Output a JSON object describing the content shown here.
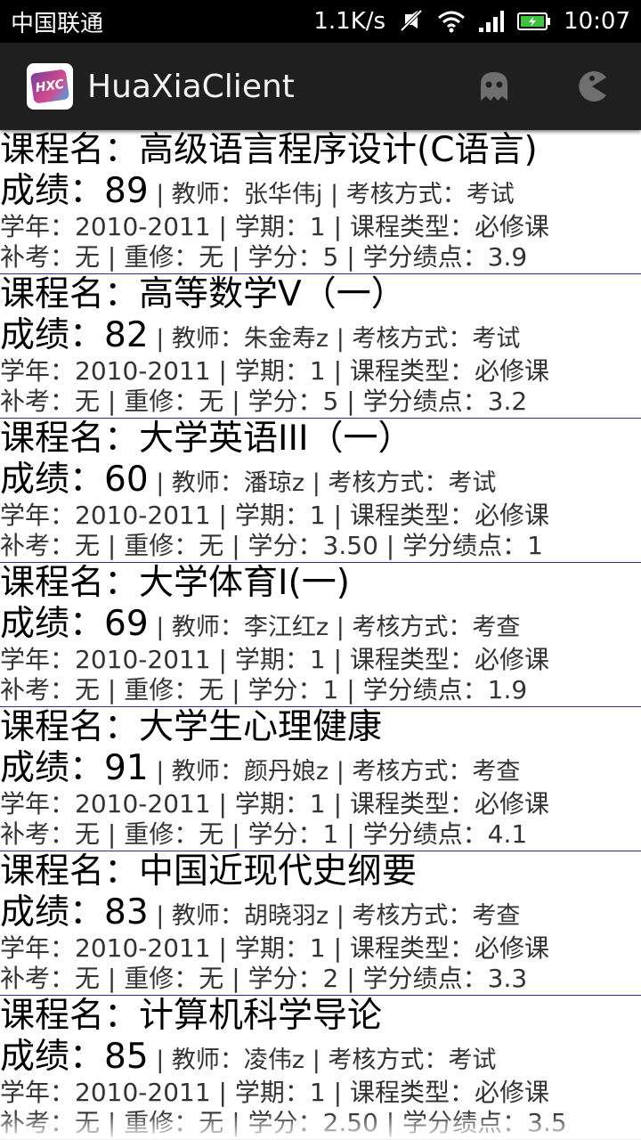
{
  "status_bar": {
    "carrier": "中国联通",
    "speed": "1.1K/s",
    "time": "10:07"
  },
  "app": {
    "title": "HuaXiaClient",
    "logo_text": "HXC"
  },
  "labels": {
    "course": "课程名：",
    "grade": "成绩：",
    "teacher": "教师：",
    "exam_type": "考核方式：",
    "year": "学年：",
    "term": "学期：",
    "course_type": "课程类型：",
    "makeup": "补考：",
    "retake": "重修：",
    "credit": "学分：",
    "gpa": "学分绩点：",
    "sep": " | "
  },
  "courses": [
    {
      "name": "高级语言程序设计(C语言)",
      "grade": "89",
      "teacher": "张华伟j",
      "exam": "考试",
      "year": "2010-2011",
      "term": "1",
      "type": "必修课",
      "makeup": "无",
      "retake": "无",
      "credit": "5",
      "gpa": "3.9"
    },
    {
      "name": "高等数学V（一）",
      "grade": "82",
      "teacher": "朱金寿z",
      "exam": "考试",
      "year": "2010-2011",
      "term": "1",
      "type": "必修课",
      "makeup": "无",
      "retake": "无",
      "credit": "5",
      "gpa": "3.2"
    },
    {
      "name": "大学英语III（一）",
      "grade": "60",
      "teacher": "潘琼z",
      "exam": "考试",
      "year": "2010-2011",
      "term": "1",
      "type": "必修课",
      "makeup": "无",
      "retake": "无",
      "credit": "3.50",
      "gpa": "1"
    },
    {
      "name": "大学体育I(一)",
      "grade": "69",
      "teacher": "李江红z",
      "exam": "考查",
      "year": "2010-2011",
      "term": "1",
      "type": "必修课",
      "makeup": "无",
      "retake": "无",
      "credit": "1",
      "gpa": "1.9"
    },
    {
      "name": "大学生心理健康",
      "grade": "91",
      "teacher": "颜丹娘z",
      "exam": "考查",
      "year": "2010-2011",
      "term": "1",
      "type": "必修课",
      "makeup": "无",
      "retake": "无",
      "credit": "1",
      "gpa": "4.1"
    },
    {
      "name": "中国近现代史纲要",
      "grade": "83",
      "teacher": "胡晓羽z",
      "exam": "考查",
      "year": "2010-2011",
      "term": "1",
      "type": "必修课",
      "makeup": "无",
      "retake": "无",
      "credit": "2",
      "gpa": "3.3"
    },
    {
      "name": "计算机科学导论",
      "grade": "85",
      "teacher": "凌伟z",
      "exam": "考试",
      "year": "2010-2011",
      "term": "1",
      "type": "必修课",
      "makeup": "无",
      "retake": "无",
      "credit": "2.50",
      "gpa": "3.5"
    }
  ]
}
